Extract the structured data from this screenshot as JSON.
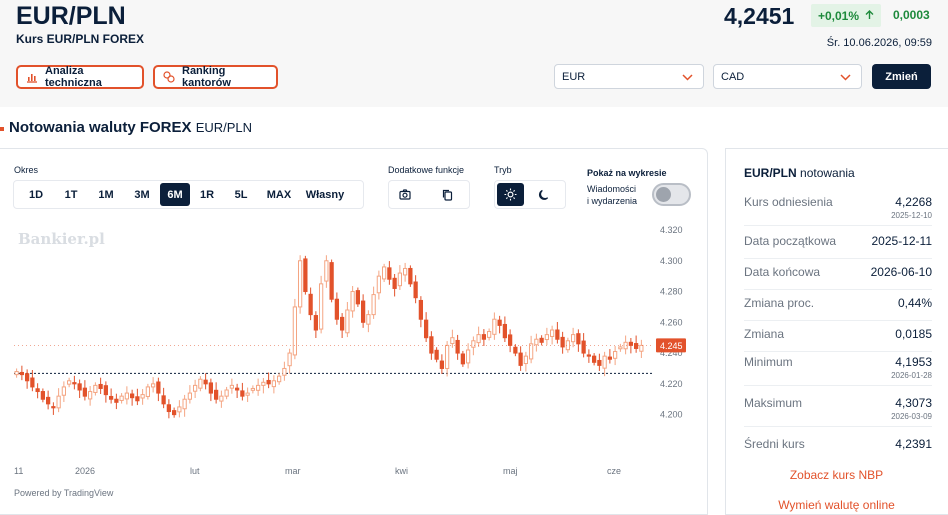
{
  "header": {
    "pair": "EUR/PLN",
    "subtitle": "Kurs EUR/PLN FOREX",
    "price": "4,2451",
    "change_pct": "+0,01%",
    "change_abs": "0,0003",
    "datetime": "Śr. 10.06.2026, 09:59",
    "technical_btn": "Analiza techniczna",
    "ranking_btn": "Ranking kantorów",
    "select_from": "EUR",
    "select_to": "CAD",
    "change_btn": "Zmień"
  },
  "section": {
    "title": "Notowania waluty FOREX",
    "pair": "EUR/PLN"
  },
  "controls": {
    "period_label": "Okres",
    "periods": [
      "1D",
      "1T",
      "1M",
      "3M",
      "6M",
      "1R",
      "5L",
      "MAX",
      "Własny"
    ],
    "active_period": "6M",
    "extra_label": "Dodatkowe funkcje",
    "mode_label": "Tryb",
    "show_label": "Pokaż na wykresie",
    "news_label_1": "Wiadomości",
    "news_label_2": "i wydarzenia",
    "news_toggle": false
  },
  "chart_data": {
    "type": "candlestick",
    "watermark": "Bankier.pl",
    "y_ticks": [
      "4.320",
      "4.300",
      "4.280",
      "4.260",
      "4.240",
      "4.220",
      "4.200"
    ],
    "ylim": [
      4.19,
      4.32
    ],
    "x_tick_labels": [
      "11",
      "2026",
      "lut",
      "mar",
      "kwi",
      "maj",
      "cze"
    ],
    "reference_level": 4.2268,
    "last_price_label": "4.245",
    "last_price": 4.245,
    "up_color": "#f4a582",
    "down_color": "#e2522b",
    "closes": [
      4.228,
      4.226,
      4.222,
      4.218,
      4.215,
      4.21,
      4.207,
      4.205,
      4.212,
      4.218,
      4.222,
      4.22,
      4.216,
      4.212,
      4.215,
      4.219,
      4.217,
      4.213,
      4.21,
      4.208,
      4.212,
      4.214,
      4.211,
      4.209,
      4.213,
      4.218,
      4.22,
      4.214,
      4.207,
      4.202,
      4.2,
      4.205,
      4.21,
      4.214,
      4.219,
      4.223,
      4.22,
      4.214,
      4.21,
      4.212,
      4.216,
      4.219,
      4.216,
      4.212,
      4.214,
      4.217,
      4.219,
      4.221,
      4.22,
      4.222,
      4.225,
      4.23,
      4.24,
      4.27,
      4.3,
      4.28,
      4.265,
      4.255,
      4.285,
      4.3,
      4.275,
      4.262,
      4.255,
      4.268,
      4.28,
      4.272,
      4.26,
      4.265,
      4.278,
      4.29,
      4.296,
      4.288,
      4.282,
      4.292,
      4.295,
      4.285,
      4.276,
      4.262,
      4.25,
      4.24,
      4.236,
      4.23,
      4.245,
      4.25,
      4.24,
      4.233,
      4.242,
      4.248,
      4.252,
      4.249,
      4.254,
      4.262,
      4.258,
      4.25,
      4.245,
      4.24,
      4.232,
      4.238,
      4.246,
      4.249,
      4.247,
      4.252,
      4.255,
      4.249,
      4.244,
      4.248,
      4.252,
      4.246,
      4.24,
      4.238,
      4.234,
      4.232,
      4.238,
      4.236,
      4.241,
      4.244,
      4.247,
      4.245,
      4.243,
      4.245
    ]
  },
  "chart_footer": "Powered by TradingView",
  "stats": {
    "title_pair": "EUR/PLN",
    "title_rest": "notowania",
    "rows": [
      {
        "label": "Kurs odniesienia",
        "value": "4,2268",
        "date": "2025-12-10"
      },
      {
        "label": "Data początkowa",
        "value": "2025-12-11",
        "date": ""
      },
      {
        "label": "Data końcowa",
        "value": "2026-06-10",
        "date": ""
      },
      {
        "label": "Zmiana proc.",
        "value": "0,44%",
        "date": ""
      },
      {
        "label": "Zmiana",
        "value": "0,0185",
        "date": ""
      },
      {
        "label": "Minimum",
        "value": "4,1953",
        "date": "2026-01-28"
      },
      {
        "label": "Maksimum",
        "value": "4,3073",
        "date": "2026-03-09"
      },
      {
        "label": "Średni kurs",
        "value": "4,2391",
        "date": ""
      }
    ],
    "link_nbp": "Zobacz kurs NBP",
    "link_exchange": "Wymień walutę online"
  },
  "colors": {
    "navy": "#0b1f3a",
    "accent": "#e2522b",
    "positive": "#1e8a3c"
  }
}
